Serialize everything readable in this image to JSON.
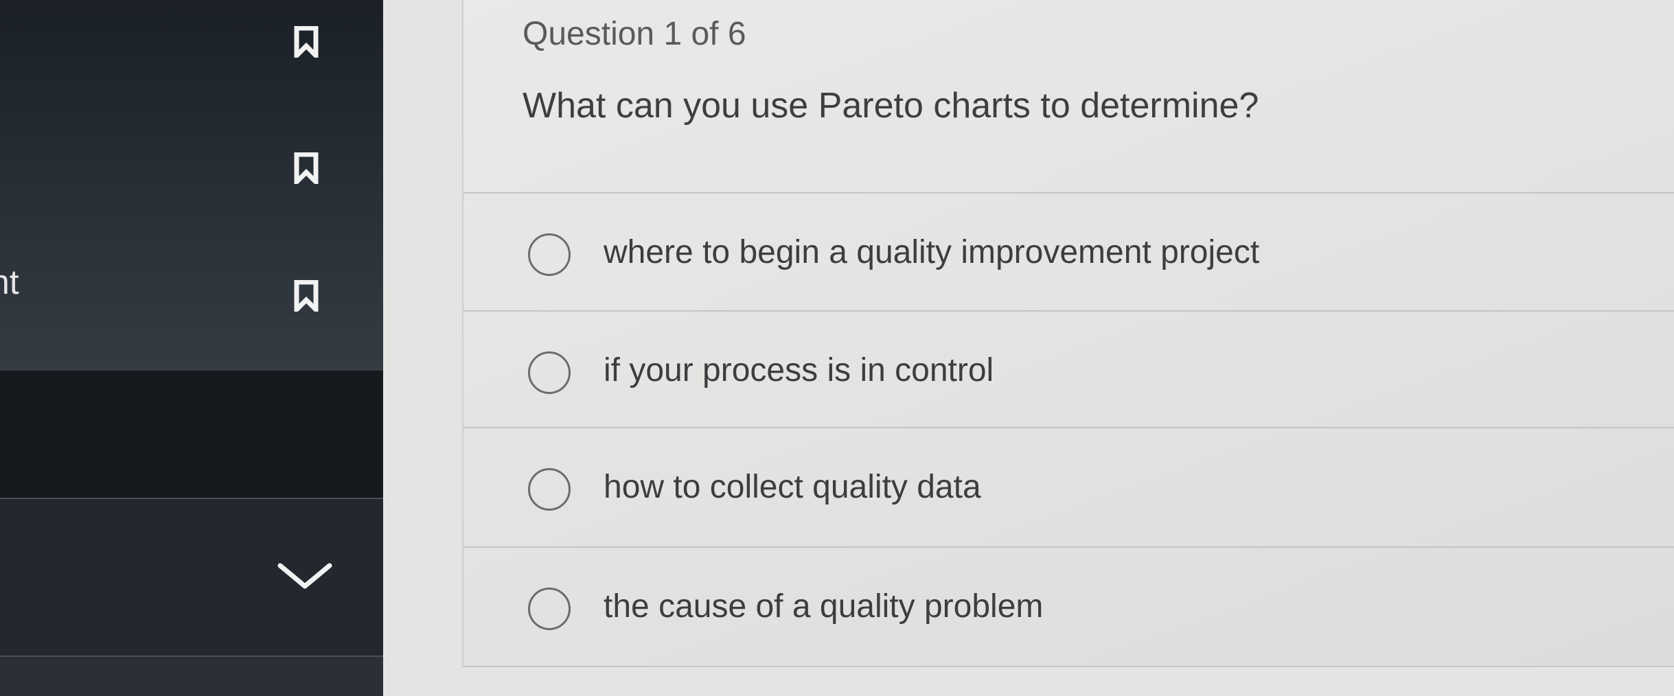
{
  "sidebar": {
    "partial_label": "nt",
    "icons": [
      "bookmark-icon",
      "bookmark-icon",
      "bookmark-icon",
      "chevron-down-icon"
    ]
  },
  "quiz": {
    "counter": "Question 1 of 6",
    "question": "What can you use Pareto charts to determine?",
    "options": [
      {
        "label": "where to begin a quality improvement project"
      },
      {
        "label": "if your process is in control"
      },
      {
        "label": "how to collect quality data"
      },
      {
        "label": "the cause of a quality problem"
      }
    ]
  },
  "colors": {
    "sidebar_bg": "#1d232a",
    "panel_bg": "#e4e4e2",
    "text": "#3e3e3e",
    "radio_border": "#6c6c6c"
  }
}
